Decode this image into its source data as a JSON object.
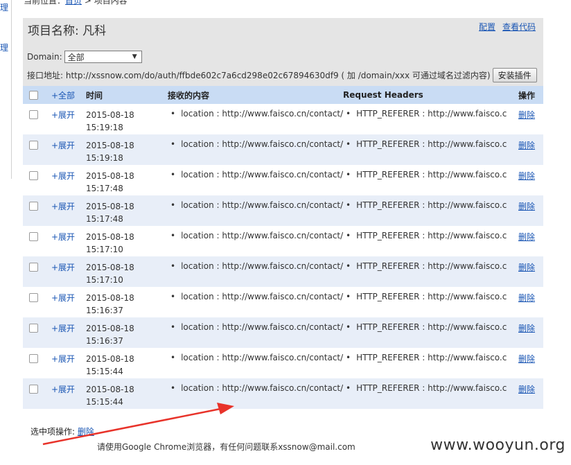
{
  "sidebar": {
    "chars": [
      "理",
      "理"
    ]
  },
  "breadcrumb": {
    "prefix": "当前位置：",
    "home": "首页",
    "sep": " > ",
    "current": "项目内容"
  },
  "project": {
    "title": "项目名称: 凡科"
  },
  "links": {
    "config": "配置",
    "view_code": "查看代码"
  },
  "domain": {
    "label": "Domain:",
    "selected": "全部"
  },
  "api": {
    "label": "接口地址: http://xssnow.com/do/auth/ffbde602c7a6cd298e02c67894630df9 ( 加 /domain/xxx 可通过域名过滤内容)",
    "install_button": "安装插件"
  },
  "table": {
    "headers": {
      "all": "+全部",
      "time": "时间",
      "content": "接收的内容",
      "headers": "Request Headers",
      "ops": "操作"
    },
    "rows": [
      {
        "expand": "+展开",
        "date": "2015-08-18",
        "time": "15:19:18",
        "content": "location : http://www.faisco.cn/contact/co",
        "header": "HTTP_REFERER : http://www.faisco.c",
        "delete": "删除"
      },
      {
        "expand": "+展开",
        "date": "2015-08-18",
        "time": "15:19:18",
        "content": "location : http://www.faisco.cn/contact/co",
        "header": "HTTP_REFERER : http://www.faisco.c",
        "delete": "删除"
      },
      {
        "expand": "+展开",
        "date": "2015-08-18",
        "time": "15:17:48",
        "content": "location : http://www.faisco.cn/contact/co",
        "header": "HTTP_REFERER : http://www.faisco.c",
        "delete": "删除"
      },
      {
        "expand": "+展开",
        "date": "2015-08-18",
        "time": "15:17:48",
        "content": "location : http://www.faisco.cn/contact/co",
        "header": "HTTP_REFERER : http://www.faisco.c",
        "delete": "删除"
      },
      {
        "expand": "+展开",
        "date": "2015-08-18",
        "time": "15:17:10",
        "content": "location : http://www.faisco.cn/contact/co",
        "header": "HTTP_REFERER : http://www.faisco.c",
        "delete": "删除"
      },
      {
        "expand": "+展开",
        "date": "2015-08-18",
        "time": "15:17:10",
        "content": "location : http://www.faisco.cn/contact/co",
        "header": "HTTP_REFERER : http://www.faisco.c",
        "delete": "删除"
      },
      {
        "expand": "+展开",
        "date": "2015-08-18",
        "time": "15:16:37",
        "content": "location : http://www.faisco.cn/contact/co",
        "header": "HTTP_REFERER : http://www.faisco.c",
        "delete": "删除"
      },
      {
        "expand": "+展开",
        "date": "2015-08-18",
        "time": "15:16:37",
        "content": "location : http://www.faisco.cn/contact/co",
        "header": "HTTP_REFERER : http://www.faisco.c",
        "delete": "删除"
      },
      {
        "expand": "+展开",
        "date": "2015-08-18",
        "time": "15:15:44",
        "content": "location : http://www.faisco.cn/contact/co",
        "header": "HTTP_REFERER : http://www.faisco.c",
        "delete": "删除"
      },
      {
        "expand": "+展开",
        "date": "2015-08-18",
        "time": "15:15:44",
        "content": "location : http://www.faisco.cn/contact/co",
        "header": "HTTP_REFERER : http://www.faisco.c",
        "delete": "删除"
      }
    ]
  },
  "bulk": {
    "label": "选中项操作:",
    "delete": "删除"
  },
  "footer": {
    "text": "请使用Google Chrome浏览器，有任何问题联系xssnow@mail.com"
  },
  "watermark": "www.wooyun.org",
  "icons": {
    "dropdown": "chevron-down-icon",
    "arrow": "red-annotation-arrow"
  },
  "colors": {
    "header_bg": "#c9dcf4",
    "alt_row": "#e8eef8",
    "panel_bg": "#e5e5e5",
    "link": "#1a56b4",
    "arrow": "#e8332a"
  }
}
